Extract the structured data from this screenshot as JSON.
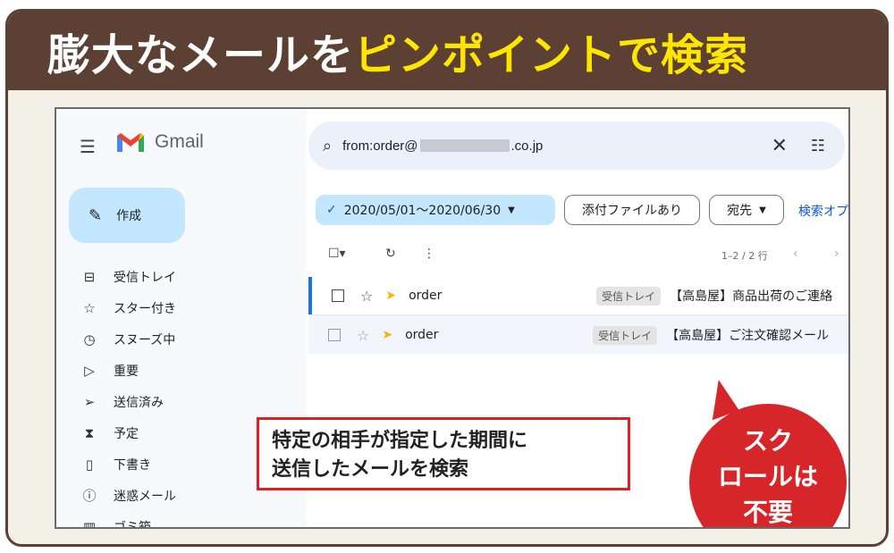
{
  "banner": {
    "title_main": "膨大なメールを",
    "title_highlight": "ピンポイントで検索"
  },
  "gmail": {
    "app_name": "Gmail",
    "compose_label": "作成",
    "nav": [
      {
        "label": "受信トレイ",
        "icon": "inbox-icon"
      },
      {
        "label": "スター付き",
        "icon": "star-icon"
      },
      {
        "label": "スヌーズ中",
        "icon": "clock-icon"
      },
      {
        "label": "重要",
        "icon": "important-icon"
      },
      {
        "label": "送信済み",
        "icon": "send-icon"
      },
      {
        "label": "予定",
        "icon": "scheduled-icon"
      },
      {
        "label": "下書き",
        "icon": "draft-icon"
      },
      {
        "label": "迷惑メール",
        "icon": "spam-icon"
      },
      {
        "label": "ゴミ箱",
        "icon": "trash-icon"
      }
    ],
    "search": {
      "query_prefix": "from:order@",
      "query_suffix": ".co.jp"
    },
    "chips": {
      "date_range": "2020/05/01〜2020/06/30",
      "attachment": "添付ファイルあり",
      "recipient": "宛先"
    },
    "advanced_search_link": "検索オプ",
    "pagination": "1–2 / 2 行",
    "emails": [
      {
        "sender": "order",
        "label": "受信トレイ",
        "subject": "【高島屋】商品出荷のご連絡"
      },
      {
        "sender": "order",
        "label": "受信トレイ",
        "subject": "【高島屋】ご注文確認メール"
      }
    ]
  },
  "callout": {
    "line1": "特定の相手が指定した期間に",
    "line2": "送信したメールを検索"
  },
  "bubble": {
    "line1": "スク",
    "line2": "ロールは",
    "line3": "不要"
  },
  "colors": {
    "banner_bg": "#5b4033",
    "highlight": "#ffe600",
    "callout_border": "#e02020",
    "bubble": "#d7262a",
    "compose_bg": "#c2e7ff"
  }
}
